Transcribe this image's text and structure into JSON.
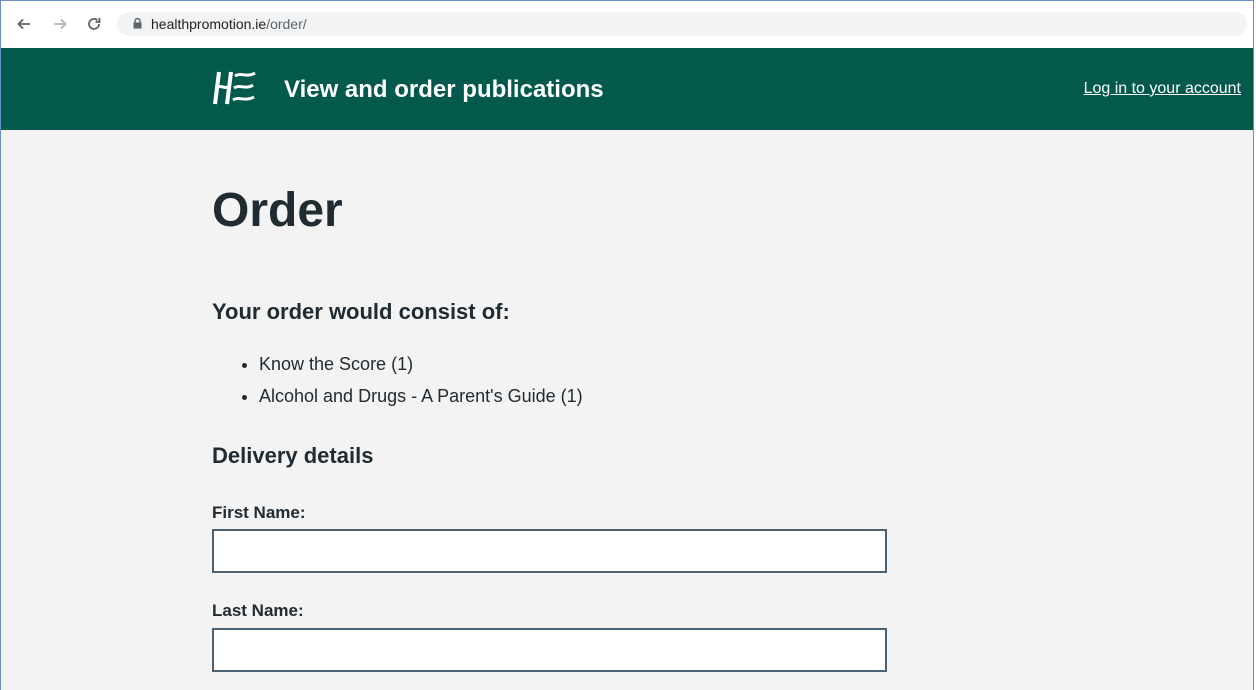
{
  "browser": {
    "url_domain": "healthpromotion.ie",
    "url_path": "/order/"
  },
  "header": {
    "title": "View and order publications",
    "login_link": "Log in to your account",
    "brand_color": "#03594c"
  },
  "main": {
    "page_title": "Order",
    "summary_heading": "Your order would consist of:",
    "order_items": [
      "Know the Score (1)",
      "Alcohol and Drugs - A Parent's Guide (1)"
    ],
    "delivery_heading": "Delivery details",
    "fields": [
      {
        "label": "First Name:",
        "value": ""
      },
      {
        "label": "Last Name:",
        "value": ""
      }
    ]
  }
}
